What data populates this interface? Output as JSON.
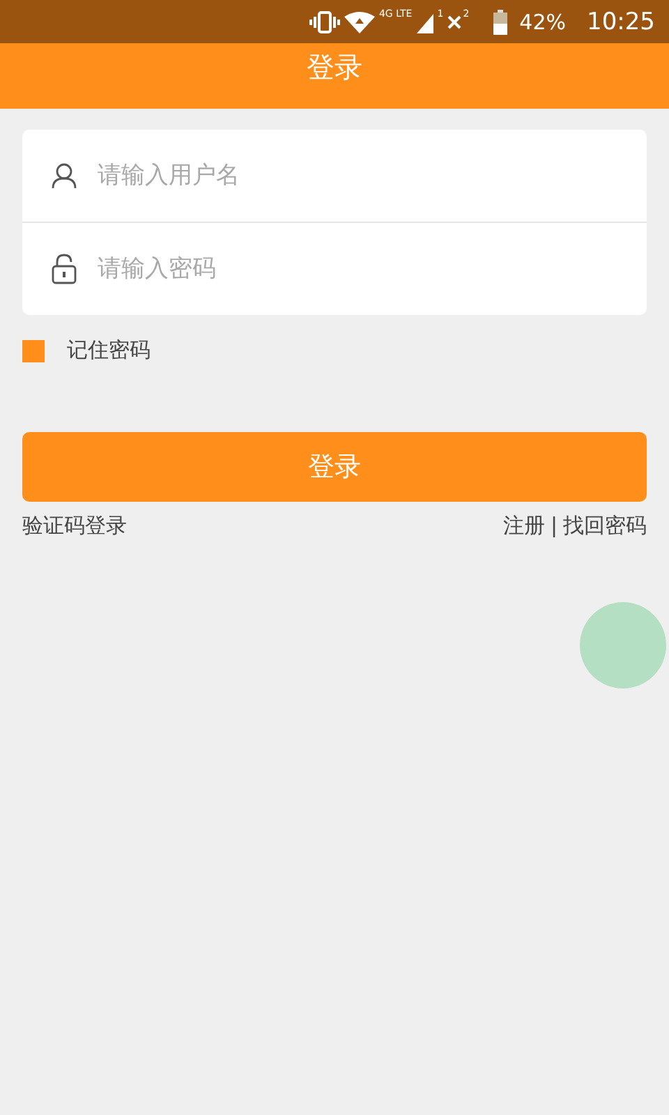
{
  "status_bar": {
    "network": "4G LTE",
    "sim_1": "1",
    "sim_2": "2",
    "battery": "42%",
    "time": "10:25"
  },
  "header": {
    "title": "登录"
  },
  "form": {
    "fields": [
      {
        "kind": "user",
        "placeholder": "请输入用户名"
      },
      {
        "kind": "lock",
        "placeholder": "请输入密码"
      }
    ],
    "remember": {
      "label": "记住密码",
      "checked": true
    },
    "submit": "登录",
    "sms_login": "验证码登录",
    "register": "注册",
    "separator": "|",
    "recover": "找回密码"
  }
}
